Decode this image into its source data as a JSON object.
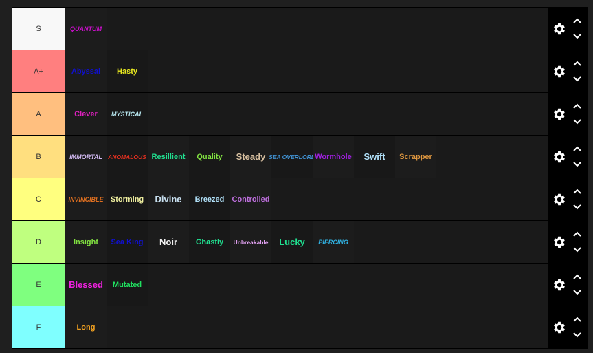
{
  "tiers": [
    {
      "label": "S",
      "color": "#f8f8f8",
      "items": [
        {
          "text": "QUANTUM",
          "color": "#c810c8",
          "style": "caps"
        }
      ]
    },
    {
      "label": "A+",
      "color": "#ff7f7f",
      "items": [
        {
          "text": "Abyssal",
          "color": "#1010d0"
        },
        {
          "text": "Hasty",
          "color": "#e8e820"
        }
      ]
    },
    {
      "label": "A",
      "color": "#ffbf7f",
      "items": [
        {
          "text": "Clever",
          "color": "#e020c0"
        },
        {
          "text": "MYSTICAL",
          "color": "#b8e8f0",
          "style": "caps"
        }
      ]
    },
    {
      "label": "B",
      "color": "#ffdf7f",
      "items": [
        {
          "text": "IMMORTAL",
          "color": "#d0b8f0",
          "style": "caps"
        },
        {
          "text": "ANOMALOUS",
          "color": "#e03020",
          "style": "caps small"
        },
        {
          "text": "Resillient",
          "color": "#20e090"
        },
        {
          "text": "Quality",
          "color": "#80e040"
        },
        {
          "text": "Steady",
          "color": "#d8c0a0",
          "style": "big"
        },
        {
          "text": "SEA OVERLORD",
          "color": "#4090d0",
          "style": "caps small"
        },
        {
          "text": "Wormhole",
          "color": "#a020e0"
        },
        {
          "text": "Swift",
          "color": "#b0e0f8",
          "style": "big"
        },
        {
          "text": "Scrapper",
          "color": "#e09840"
        }
      ]
    },
    {
      "label": "C",
      "color": "#ffff7f",
      "items": [
        {
          "text": "INVINCIBLE",
          "color": "#e07020",
          "style": "caps"
        },
        {
          "text": "Storming",
          "color": "#f0f0a0"
        },
        {
          "text": "Divine",
          "color": "#c8e0f0",
          "style": "big"
        },
        {
          "text": "Breezed",
          "color": "#b0e0f8"
        },
        {
          "text": "Controlled",
          "color": "#c070e0"
        }
      ]
    },
    {
      "label": "D",
      "color": "#bfff7f",
      "items": [
        {
          "text": "Insight",
          "color": "#80e040"
        },
        {
          "text": "Sea King",
          "color": "#1010d0"
        },
        {
          "text": "Noir",
          "color": "#f0f0f0",
          "style": "big"
        },
        {
          "text": "Ghastly",
          "color": "#20e090"
        },
        {
          "text": "Unbreakable",
          "color": "#e0a0f0",
          "style": "small"
        },
        {
          "text": "Lucky",
          "color": "#20e090",
          "style": "big"
        },
        {
          "text": "PIERCING",
          "color": "#30b0e0",
          "style": "caps"
        }
      ]
    },
    {
      "label": "E",
      "color": "#7fff7f",
      "items": [
        {
          "text": "Blessed",
          "color": "#f020e0",
          "style": "big"
        },
        {
          "text": "Mutated",
          "color": "#20e060"
        }
      ]
    },
    {
      "label": "F",
      "color": "#7fffff",
      "items": [
        {
          "text": "Long",
          "color": "#f0a020"
        }
      ]
    }
  ]
}
